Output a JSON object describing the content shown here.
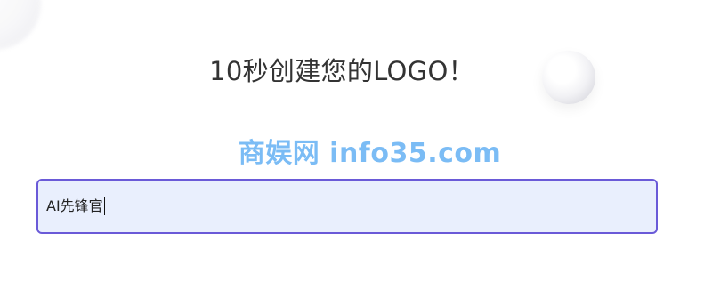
{
  "headline": {
    "text": "10秒创建您的LOGO！"
  },
  "watermark": {
    "text": "商娱网 info35.com",
    "color": "#7bbcf5"
  },
  "logo_name_input": {
    "value": "AI先锋官",
    "border_color": "#6a5ad8",
    "background_color": "#e9effd"
  },
  "decorations": {
    "top_left": "soft-sphere",
    "right": "white-sphere"
  }
}
